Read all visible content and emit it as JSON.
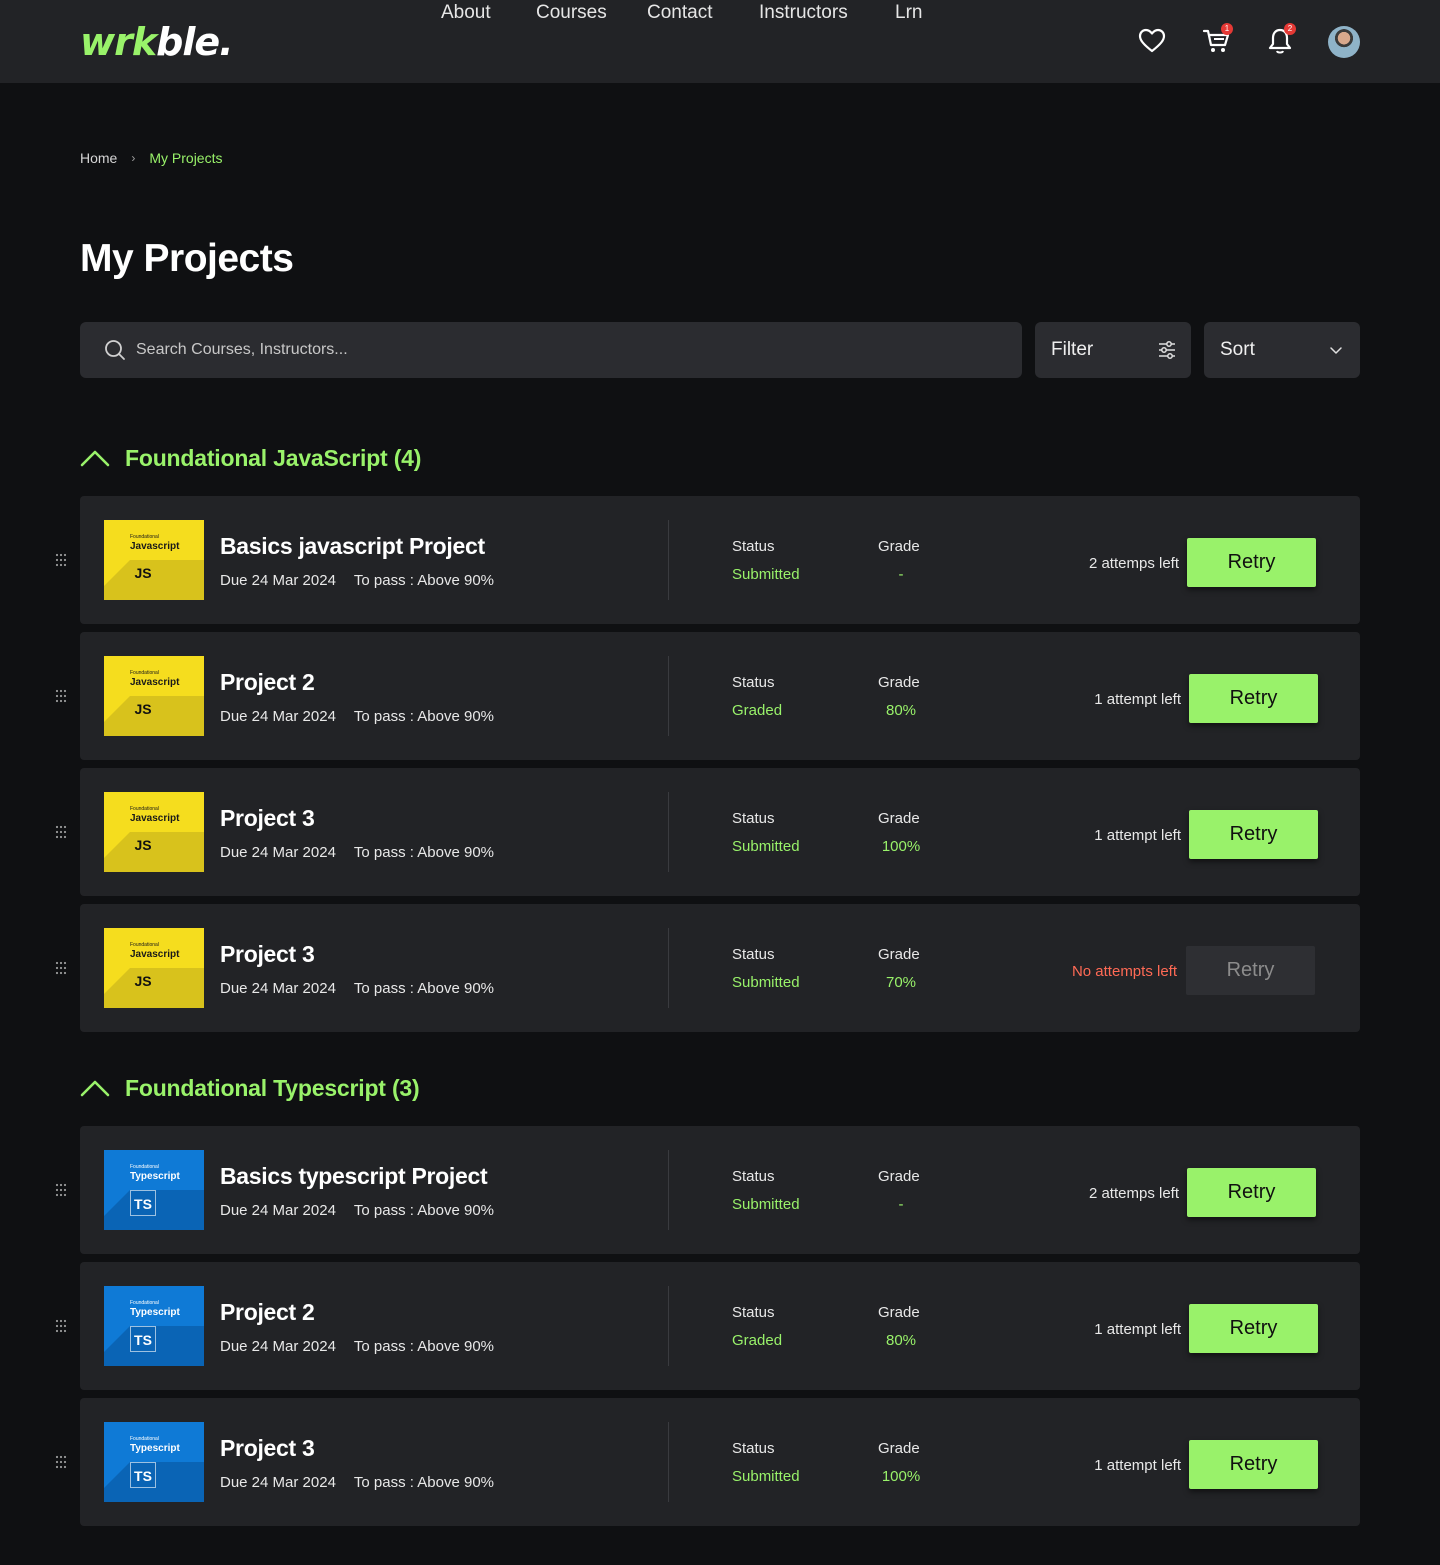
{
  "brand": {
    "logo_green": "wrk",
    "logo_white": "ble.",
    "accent": "#99f26a"
  },
  "nav": {
    "links": [
      "About",
      "Courses",
      "Contact",
      "Instructors",
      "Lrn"
    ],
    "icons": [
      "heart-icon",
      "cart-icon",
      "bell-icon"
    ],
    "cart_badge": "1",
    "bell_badge": "2"
  },
  "breadcrumb": {
    "home": "Home",
    "separator": "›",
    "current": "My Projects"
  },
  "page_title": "My Projects",
  "search": {
    "placeholder": "Search Courses, Instructors..."
  },
  "filter": {
    "label": "Filter"
  },
  "sort": {
    "label": "Sort"
  },
  "labels": {
    "status": "Status",
    "grade": "Grade",
    "retry": "Retry"
  },
  "sections": [
    {
      "title": "Foundational JavaScript (4)",
      "thumb": {
        "small": "Foundational",
        "name": "Javascript",
        "box": "JS"
      },
      "projects": [
        {
          "title": "Basics javascript Project",
          "due": "Due 24 Mar 2024",
          "pass": "To pass : Above 90%",
          "status": "Submitted",
          "grade": "-",
          "attempts": "2 attemps left"
        },
        {
          "title": "Project 2",
          "due": "Due 24 Mar 2024",
          "pass": "To pass : Above 90%",
          "status": "Graded",
          "grade": "80%",
          "attempts": "1 attempt left"
        },
        {
          "title": "Project 3",
          "due": "Due 24 Mar 2024",
          "pass": "To pass : Above 90%",
          "status": "Submitted",
          "grade": "100%",
          "attempts": "1 attempt left"
        },
        {
          "title": "Project 3",
          "due": "Due 24 Mar 2024",
          "pass": "To pass : Above 90%",
          "status": "Submitted",
          "grade": "70%",
          "attempts": "No attempts left"
        }
      ]
    },
    {
      "title": "Foundational Typescript (3)",
      "thumb": {
        "small": "Foundational",
        "name": "Typescript",
        "box": "TS"
      },
      "projects": [
        {
          "title": "Basics typescript Project",
          "due": "Due 24 Mar 2024",
          "pass": "To pass : Above 90%",
          "status": "Submitted",
          "grade": "-",
          "attempts": "2 attemps left"
        },
        {
          "title": "Project 2",
          "due": "Due 24 Mar 2024",
          "pass": "To pass : Above 90%",
          "status": "Graded",
          "grade": "80%",
          "attempts": "1 attempt left"
        },
        {
          "title": "Project 3",
          "due": "Due 24 Mar 2024",
          "pass": "To pass : Above 90%",
          "status": "Submitted",
          "grade": "100%",
          "attempts": "1 attempt left"
        }
      ]
    }
  ]
}
